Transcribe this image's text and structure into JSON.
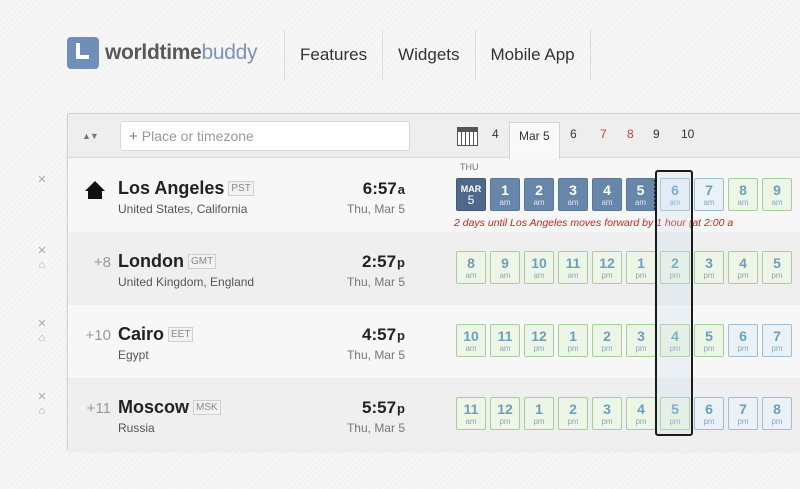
{
  "header": {
    "logo_bold": "worldtime",
    "logo_light": "buddy",
    "nav": [
      "Features",
      "Widgets",
      "Mobile App"
    ]
  },
  "toolbar": {
    "sort_icon": "sort-arrows-icon",
    "search_placeholder": "Place or timezone",
    "dates": [
      {
        "label": "4",
        "weekend": false,
        "active": false
      },
      {
        "label": "Mar 5",
        "weekend": false,
        "active": true
      },
      {
        "label": "6",
        "weekend": false,
        "active": false
      },
      {
        "label": "7",
        "weekend": true,
        "active": false
      },
      {
        "label": "8",
        "weekend": true,
        "active": false
      },
      {
        "label": "9",
        "weekend": false,
        "active": false
      },
      {
        "label": "10",
        "weekend": false,
        "active": false
      }
    ]
  },
  "rows": [
    {
      "offset": "",
      "is_home": true,
      "city": "Los Angeles",
      "tz": "PST",
      "region": "United States, California",
      "time": "6:57",
      "ampm": "a",
      "date": "Thu, Mar 5",
      "weekday": "THU",
      "dst_note": "2 days until Los Angeles moves forward by 1 hour (at 2:00 a",
      "hours": [
        {
          "n": "MAR",
          "p": "5",
          "style": "m"
        },
        {
          "n": "1",
          "p": "am",
          "style": "d"
        },
        {
          "n": "2",
          "p": "am",
          "style": "d"
        },
        {
          "n": "3",
          "p": "am",
          "style": "d"
        },
        {
          "n": "4",
          "p": "am",
          "style": "d"
        },
        {
          "n": "5",
          "p": "am",
          "style": "d dot"
        },
        {
          "n": "6",
          "p": "am",
          "style": "b"
        },
        {
          "n": "7",
          "p": "am",
          "style": "b"
        },
        {
          "n": "8",
          "p": "am",
          "style": "g"
        },
        {
          "n": "9",
          "p": "am",
          "style": "g"
        }
      ]
    },
    {
      "offset": "+8",
      "is_home": false,
      "city": "London",
      "tz": "GMT",
      "region": "United Kingdom, England",
      "time": "2:57",
      "ampm": "p",
      "date": "Thu, Mar 5",
      "hours": [
        {
          "n": "8",
          "p": "am",
          "style": "g"
        },
        {
          "n": "9",
          "p": "am",
          "style": "g"
        },
        {
          "n": "10",
          "p": "am",
          "style": "g"
        },
        {
          "n": "11",
          "p": "am",
          "style": "g"
        },
        {
          "n": "12",
          "p": "pm",
          "style": "g"
        },
        {
          "n": "1",
          "p": "pm",
          "style": "g"
        },
        {
          "n": "2",
          "p": "pm",
          "style": "g"
        },
        {
          "n": "3",
          "p": "pm",
          "style": "g"
        },
        {
          "n": "4",
          "p": "pm",
          "style": "g"
        },
        {
          "n": "5",
          "p": "pm",
          "style": "g"
        }
      ]
    },
    {
      "offset": "+10",
      "is_home": false,
      "city": "Cairo",
      "tz": "EET",
      "region": "Egypt",
      "time": "4:57",
      "ampm": "p",
      "date": "Thu, Mar 5",
      "hours": [
        {
          "n": "10",
          "p": "am",
          "style": "g"
        },
        {
          "n": "11",
          "p": "am",
          "style": "g"
        },
        {
          "n": "12",
          "p": "pm",
          "style": "g"
        },
        {
          "n": "1",
          "p": "pm",
          "style": "g"
        },
        {
          "n": "2",
          "p": "pm",
          "style": "g"
        },
        {
          "n": "3",
          "p": "pm",
          "style": "g"
        },
        {
          "n": "4",
          "p": "pm",
          "style": "g"
        },
        {
          "n": "5",
          "p": "pm",
          "style": "g"
        },
        {
          "n": "6",
          "p": "pm",
          "style": "b"
        },
        {
          "n": "7",
          "p": "pm",
          "style": "b"
        }
      ]
    },
    {
      "offset": "+11",
      "is_home": false,
      "city": "Moscow",
      "tz": "MSK",
      "region": "Russia",
      "time": "5:57",
      "ampm": "p",
      "date": "Thu, Mar 5",
      "hours": [
        {
          "n": "11",
          "p": "am",
          "style": "g"
        },
        {
          "n": "12",
          "p": "pm",
          "style": "g"
        },
        {
          "n": "1",
          "p": "pm",
          "style": "g"
        },
        {
          "n": "2",
          "p": "pm",
          "style": "g"
        },
        {
          "n": "3",
          "p": "pm",
          "style": "g"
        },
        {
          "n": "4",
          "p": "pm",
          "style": "g"
        },
        {
          "n": "5",
          "p": "pm",
          "style": "g"
        },
        {
          "n": "6",
          "p": "pm",
          "style": "b"
        },
        {
          "n": "7",
          "p": "pm",
          "style": "b"
        },
        {
          "n": "8",
          "p": "pm",
          "style": "b"
        }
      ]
    }
  ]
}
